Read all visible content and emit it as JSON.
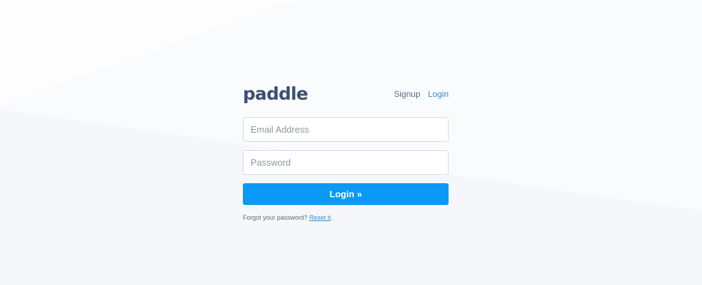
{
  "brand": {
    "logo_text": "paddle",
    "logo_color": "#3b4f73"
  },
  "nav": {
    "signup_label": "Signup",
    "login_label": "Login"
  },
  "form": {
    "email": {
      "value": "",
      "placeholder": "Email Address"
    },
    "password": {
      "value": "",
      "placeholder": "Password"
    },
    "submit_label": "Login »",
    "submit_color": "#0a99f4"
  },
  "forgot": {
    "prefix": "Forgot your password?",
    "link_label": "Reset it",
    "suffix": "."
  },
  "colors": {
    "link": "#2f8fd8",
    "background": "#fafbfc"
  }
}
